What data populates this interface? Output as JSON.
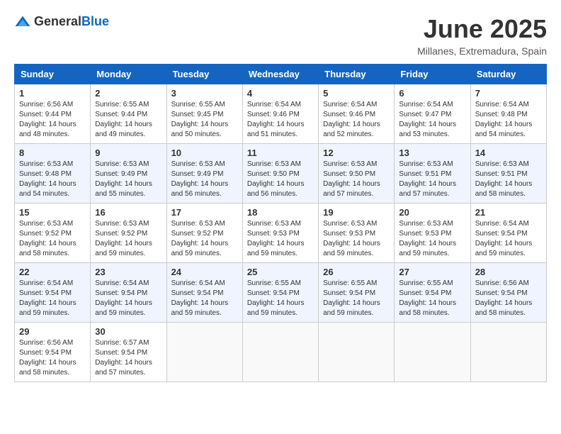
{
  "header": {
    "logo_general": "General",
    "logo_blue": "Blue",
    "month_title": "June 2025",
    "location": "Millanes, Extremadura, Spain"
  },
  "weekdays": [
    "Sunday",
    "Monday",
    "Tuesday",
    "Wednesday",
    "Thursday",
    "Friday",
    "Saturday"
  ],
  "weeks": [
    [
      {
        "day": "1",
        "sunrise": "Sunrise: 6:56 AM",
        "sunset": "Sunset: 9:44 PM",
        "daylight": "Daylight: 14 hours and 48 minutes."
      },
      {
        "day": "2",
        "sunrise": "Sunrise: 6:55 AM",
        "sunset": "Sunset: 9:44 PM",
        "daylight": "Daylight: 14 hours and 49 minutes."
      },
      {
        "day": "3",
        "sunrise": "Sunrise: 6:55 AM",
        "sunset": "Sunset: 9:45 PM",
        "daylight": "Daylight: 14 hours and 50 minutes."
      },
      {
        "day": "4",
        "sunrise": "Sunrise: 6:54 AM",
        "sunset": "Sunset: 9:46 PM",
        "daylight": "Daylight: 14 hours and 51 minutes."
      },
      {
        "day": "5",
        "sunrise": "Sunrise: 6:54 AM",
        "sunset": "Sunset: 9:46 PM",
        "daylight": "Daylight: 14 hours and 52 minutes."
      },
      {
        "day": "6",
        "sunrise": "Sunrise: 6:54 AM",
        "sunset": "Sunset: 9:47 PM",
        "daylight": "Daylight: 14 hours and 53 minutes."
      },
      {
        "day": "7",
        "sunrise": "Sunrise: 6:54 AM",
        "sunset": "Sunset: 9:48 PM",
        "daylight": "Daylight: 14 hours and 54 minutes."
      }
    ],
    [
      {
        "day": "8",
        "sunrise": "Sunrise: 6:53 AM",
        "sunset": "Sunset: 9:48 PM",
        "daylight": "Daylight: 14 hours and 54 minutes."
      },
      {
        "day": "9",
        "sunrise": "Sunrise: 6:53 AM",
        "sunset": "Sunset: 9:49 PM",
        "daylight": "Daylight: 14 hours and 55 minutes."
      },
      {
        "day": "10",
        "sunrise": "Sunrise: 6:53 AM",
        "sunset": "Sunset: 9:49 PM",
        "daylight": "Daylight: 14 hours and 56 minutes."
      },
      {
        "day": "11",
        "sunrise": "Sunrise: 6:53 AM",
        "sunset": "Sunset: 9:50 PM",
        "daylight": "Daylight: 14 hours and 56 minutes."
      },
      {
        "day": "12",
        "sunrise": "Sunrise: 6:53 AM",
        "sunset": "Sunset: 9:50 PM",
        "daylight": "Daylight: 14 hours and 57 minutes."
      },
      {
        "day": "13",
        "sunrise": "Sunrise: 6:53 AM",
        "sunset": "Sunset: 9:51 PM",
        "daylight": "Daylight: 14 hours and 57 minutes."
      },
      {
        "day": "14",
        "sunrise": "Sunrise: 6:53 AM",
        "sunset": "Sunset: 9:51 PM",
        "daylight": "Daylight: 14 hours and 58 minutes."
      }
    ],
    [
      {
        "day": "15",
        "sunrise": "Sunrise: 6:53 AM",
        "sunset": "Sunset: 9:52 PM",
        "daylight": "Daylight: 14 hours and 58 minutes."
      },
      {
        "day": "16",
        "sunrise": "Sunrise: 6:53 AM",
        "sunset": "Sunset: 9:52 PM",
        "daylight": "Daylight: 14 hours and 59 minutes."
      },
      {
        "day": "17",
        "sunrise": "Sunrise: 6:53 AM",
        "sunset": "Sunset: 9:52 PM",
        "daylight": "Daylight: 14 hours and 59 minutes."
      },
      {
        "day": "18",
        "sunrise": "Sunrise: 6:53 AM",
        "sunset": "Sunset: 9:53 PM",
        "daylight": "Daylight: 14 hours and 59 minutes."
      },
      {
        "day": "19",
        "sunrise": "Sunrise: 6:53 AM",
        "sunset": "Sunset: 9:53 PM",
        "daylight": "Daylight: 14 hours and 59 minutes."
      },
      {
        "day": "20",
        "sunrise": "Sunrise: 6:53 AM",
        "sunset": "Sunset: 9:53 PM",
        "daylight": "Daylight: 14 hours and 59 minutes."
      },
      {
        "day": "21",
        "sunrise": "Sunrise: 6:54 AM",
        "sunset": "Sunset: 9:54 PM",
        "daylight": "Daylight: 14 hours and 59 minutes."
      }
    ],
    [
      {
        "day": "22",
        "sunrise": "Sunrise: 6:54 AM",
        "sunset": "Sunset: 9:54 PM",
        "daylight": "Daylight: 14 hours and 59 minutes."
      },
      {
        "day": "23",
        "sunrise": "Sunrise: 6:54 AM",
        "sunset": "Sunset: 9:54 PM",
        "daylight": "Daylight: 14 hours and 59 minutes."
      },
      {
        "day": "24",
        "sunrise": "Sunrise: 6:54 AM",
        "sunset": "Sunset: 9:54 PM",
        "daylight": "Daylight: 14 hours and 59 minutes."
      },
      {
        "day": "25",
        "sunrise": "Sunrise: 6:55 AM",
        "sunset": "Sunset: 9:54 PM",
        "daylight": "Daylight: 14 hours and 59 minutes."
      },
      {
        "day": "26",
        "sunrise": "Sunrise: 6:55 AM",
        "sunset": "Sunset: 9:54 PM",
        "daylight": "Daylight: 14 hours and 59 minutes."
      },
      {
        "day": "27",
        "sunrise": "Sunrise: 6:55 AM",
        "sunset": "Sunset: 9:54 PM",
        "daylight": "Daylight: 14 hours and 58 minutes."
      },
      {
        "day": "28",
        "sunrise": "Sunrise: 6:56 AM",
        "sunset": "Sunset: 9:54 PM",
        "daylight": "Daylight: 14 hours and 58 minutes."
      }
    ],
    [
      {
        "day": "29",
        "sunrise": "Sunrise: 6:56 AM",
        "sunset": "Sunset: 9:54 PM",
        "daylight": "Daylight: 14 hours and 58 minutes."
      },
      {
        "day": "30",
        "sunrise": "Sunrise: 6:57 AM",
        "sunset": "Sunset: 9:54 PM",
        "daylight": "Daylight: 14 hours and 57 minutes."
      },
      null,
      null,
      null,
      null,
      null
    ]
  ]
}
